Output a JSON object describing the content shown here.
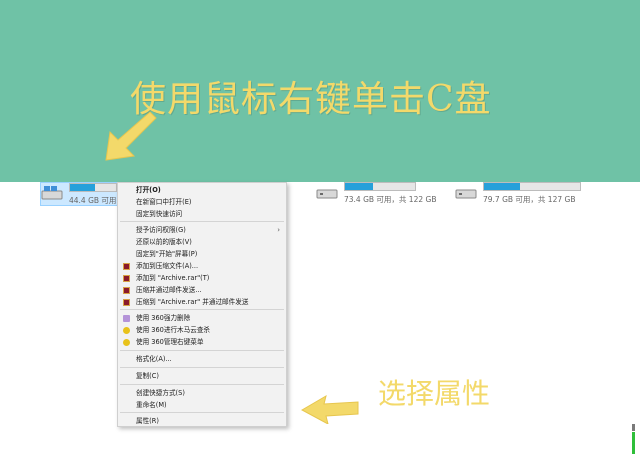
{
  "banner": {
    "headline": "使用鼠标右键单击C盘",
    "bg_color": "#6fc2a6",
    "text_color": "#f3d96a"
  },
  "caption_bottom": "选择属性",
  "drives": [
    {
      "size_text": "44.4 GB 可用，",
      "fill_fraction": 0.55,
      "selected": true
    },
    {
      "size_text": "73.4 GB 可用，共 122 GB",
      "fill_fraction": 0.4,
      "selected": false
    },
    {
      "size_text": "79.7 GB 可用，共 127 GB",
      "fill_fraction": 0.37,
      "selected": false
    }
  ],
  "context_menu": {
    "items": [
      {
        "label": "打开(O)",
        "icon": "",
        "bold": true
      },
      {
        "label": "在新窗口中打开(E)",
        "icon": ""
      },
      {
        "label": "固定到快速访问",
        "icon": ""
      },
      {
        "label": "授予访问权限(G)",
        "icon": "",
        "submenu": true
      },
      {
        "label": "还原以前的版本(V)",
        "icon": ""
      },
      {
        "label": "固定到\"开始\"屏幕(P)",
        "icon": ""
      },
      {
        "label": "添加到压缩文件(A)...",
        "icon": "winrar-icon"
      },
      {
        "label": "添加到 \"Archive.rar\"(T)",
        "icon": "winrar-icon"
      },
      {
        "label": "压缩并通过邮件发送...",
        "icon": "winrar-icon"
      },
      {
        "label": "压缩到 \"Archive.rar\" 并通过邮件发送",
        "icon": "winrar-icon"
      },
      {
        "label": "使用 360强力删除",
        "icon": "360-delete-icon"
      },
      {
        "label": "使用 360进行木马云查杀",
        "icon": "360-icon"
      },
      {
        "label": "使用 360管理右键菜单",
        "icon": "360-icon"
      },
      {
        "label": "格式化(A)...",
        "icon": ""
      },
      {
        "label": "复制(C)",
        "icon": ""
      },
      {
        "label": "创建快捷方式(S)",
        "icon": ""
      },
      {
        "label": "重命名(M)",
        "icon": ""
      },
      {
        "label": "属性(R)",
        "icon": ""
      }
    ],
    "submenu_arrow": "›"
  },
  "colors": {
    "accent_arrow": "#f3d96a",
    "drive_fill": "#26a0da"
  }
}
